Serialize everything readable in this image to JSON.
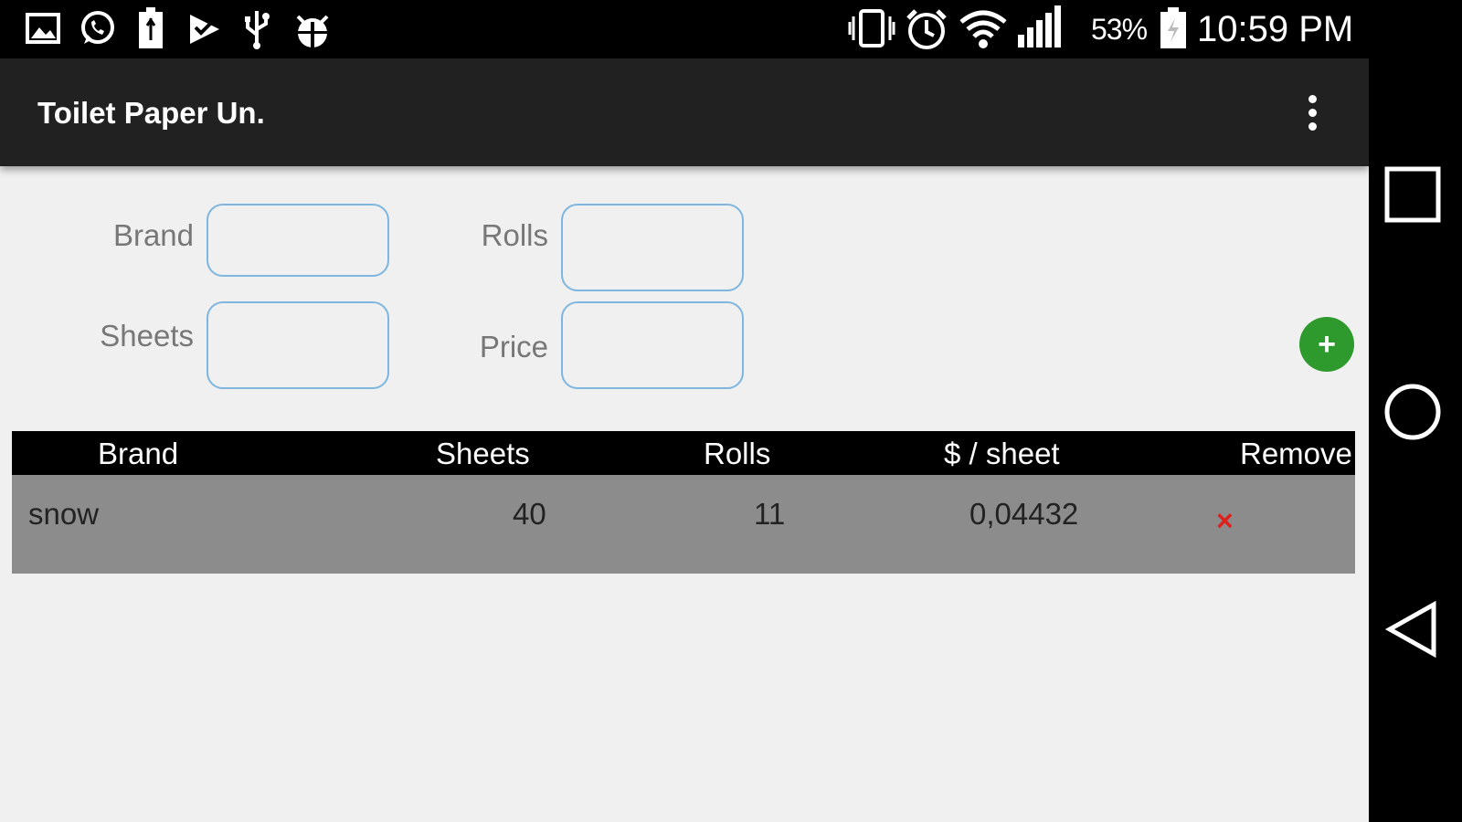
{
  "status_bar": {
    "left_icons": [
      "gallery-icon",
      "whatsapp-icon",
      "usb-battery-icon",
      "play-store-icon",
      "usb-icon",
      "android-debug-icon"
    ],
    "right_icons": [
      "vibrate-icon",
      "alarm-icon",
      "wifi-icon",
      "signal-icon",
      "battery-icon"
    ],
    "battery_percent": "53%",
    "time": "10:59 PM"
  },
  "action_bar": {
    "title": "Toilet Paper Un.",
    "overflow_icon": "more-vert-icon"
  },
  "form": {
    "brand_label": "Brand",
    "rolls_label": "Rolls",
    "sheets_label": "Sheets",
    "price_label": "Price",
    "brand_value": "",
    "rolls_value": "",
    "sheets_value": "",
    "price_value": "",
    "add_button_label": "+"
  },
  "table": {
    "headers": [
      "Brand",
      "Sheets",
      "Rolls",
      "$ / sheet",
      "Remove"
    ],
    "rows": [
      {
        "brand": "snow",
        "sheets": "40",
        "rolls": "11",
        "price_per_sheet": "0,04432",
        "remove": "×"
      }
    ]
  },
  "nav_bar": {
    "icons": [
      "recents-square-icon",
      "home-circle-icon",
      "back-triangle-icon"
    ]
  },
  "colors": {
    "action_bar": "#212121",
    "background": "#f0f0f0",
    "field_border": "#7fb6df",
    "add_button": "#2e9a2e",
    "table_header": "#000000",
    "table_row": "#8c8c8c",
    "remove_icon": "#e0201c"
  }
}
